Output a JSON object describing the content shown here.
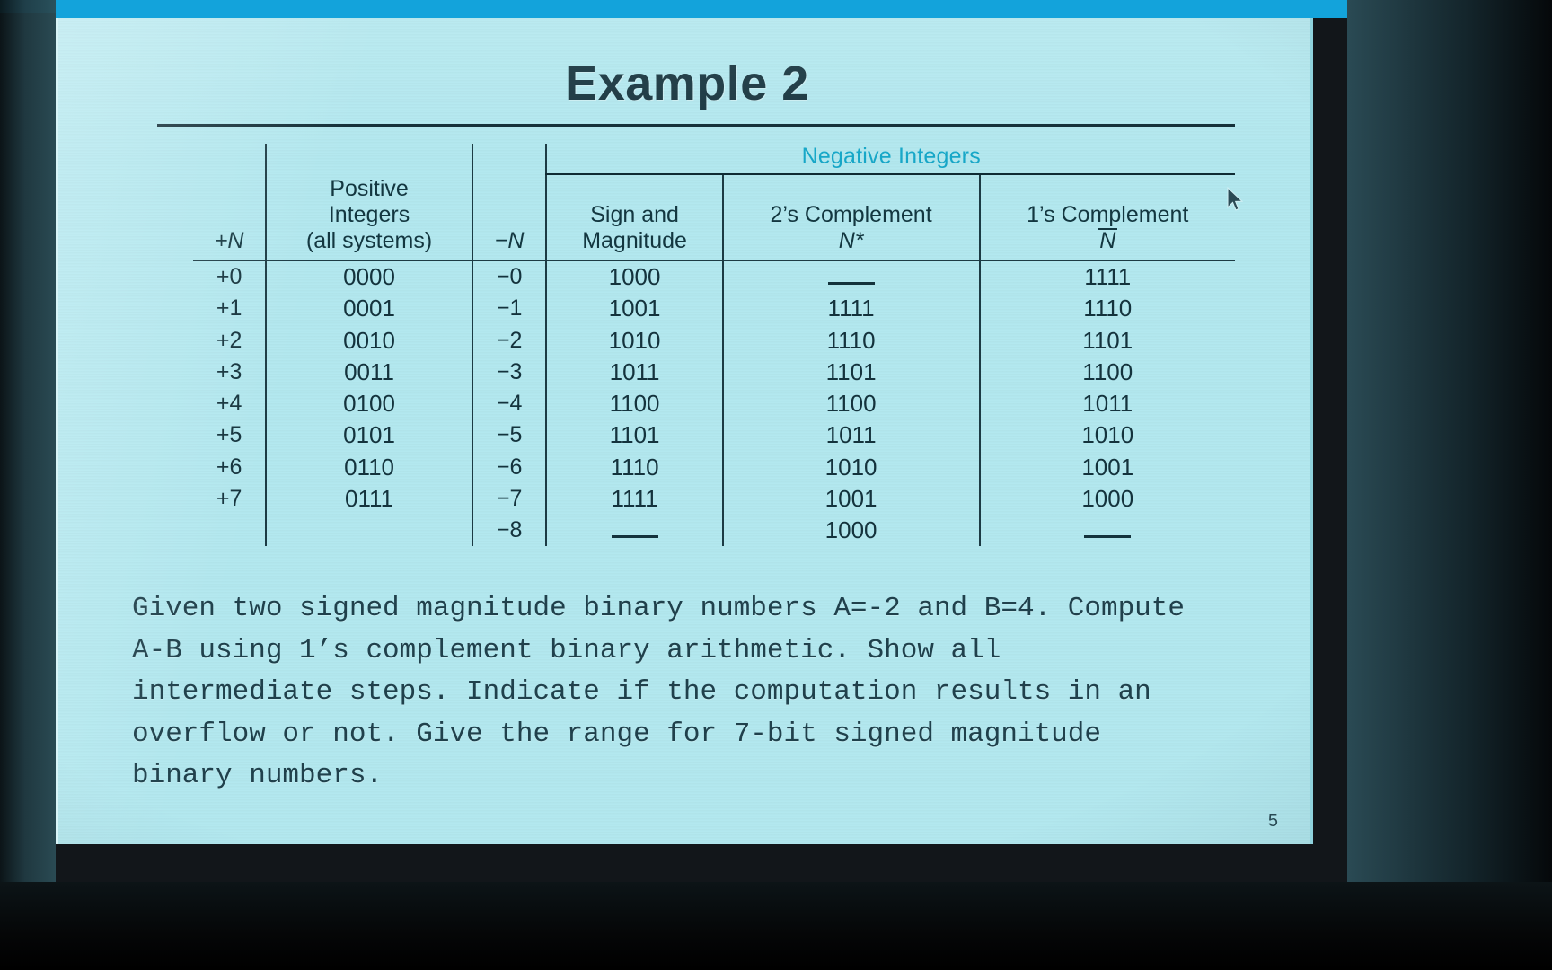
{
  "slide": {
    "title": "Example 2",
    "number": "5"
  },
  "table": {
    "group_headers": [
      {
        "label": "",
        "span": 1
      },
      {
        "label": "Negative Integers",
        "span": 3
      }
    ],
    "negative_group_label": "Negative Integers",
    "columns": [
      {
        "id": "plus_n",
        "line1": "",
        "line2": "",
        "line3": "+N"
      },
      {
        "id": "positive",
        "line1": "Positive",
        "line2": "Integers",
        "line3": "(all systems)"
      },
      {
        "id": "minus_n",
        "line1": "",
        "line2": "",
        "line3": "−N"
      },
      {
        "id": "sign_mag",
        "line1": "",
        "line2": "Sign and",
        "line3": "Magnitude"
      },
      {
        "id": "twos",
        "line1": "",
        "line2": "2’s Complement",
        "line3": "N*"
      },
      {
        "id": "ones",
        "line1": "",
        "line2": "1’s Complement",
        "line3": "N"
      }
    ],
    "rows": [
      {
        "plus_n": "+0",
        "positive": "0000",
        "minus_n": "−0",
        "sign_mag": "1000",
        "twos": "—",
        "ones": "1111"
      },
      {
        "plus_n": "+1",
        "positive": "0001",
        "minus_n": "−1",
        "sign_mag": "1001",
        "twos": "1111",
        "ones": "1110"
      },
      {
        "plus_n": "+2",
        "positive": "0010",
        "minus_n": "−2",
        "sign_mag": "1010",
        "twos": "1110",
        "ones": "1101"
      },
      {
        "plus_n": "+3",
        "positive": "0011",
        "minus_n": "−3",
        "sign_mag": "1011",
        "twos": "1101",
        "ones": "1100"
      },
      {
        "plus_n": "+4",
        "positive": "0100",
        "minus_n": "−4",
        "sign_mag": "1100",
        "twos": "1100",
        "ones": "1011"
      },
      {
        "plus_n": "+5",
        "positive": "0101",
        "minus_n": "−5",
        "sign_mag": "1101",
        "twos": "1011",
        "ones": "1010"
      },
      {
        "plus_n": "+6",
        "positive": "0110",
        "minus_n": "−6",
        "sign_mag": "1110",
        "twos": "1010",
        "ones": "1001"
      },
      {
        "plus_n": "+7",
        "positive": "0111",
        "minus_n": "−7",
        "sign_mag": "1111",
        "twos": "1001",
        "ones": "1000"
      },
      {
        "plus_n": "",
        "positive": "",
        "minus_n": "−8",
        "sign_mag": "—",
        "twos": "1000",
        "ones": "—"
      }
    ]
  },
  "question": {
    "line1": "Given two signed magnitude binary numbers A=-2 and B=4. Compute",
    "line2": "A-B using 1’s complement binary arithmetic. Show all",
    "line3": "intermediate steps. Indicate if the computation results in an",
    "line4": "overflow or not. Give the range for 7-bit signed magnitude",
    "line5": "binary numbers."
  },
  "colors": {
    "slide_background": "#b3e8ef",
    "accent_heading": "#16a8c9",
    "text": "#14333d",
    "window_chrome": "#13a3db",
    "bezel": "#0b1417"
  },
  "cursor": {
    "type": "arrow-pointer"
  }
}
